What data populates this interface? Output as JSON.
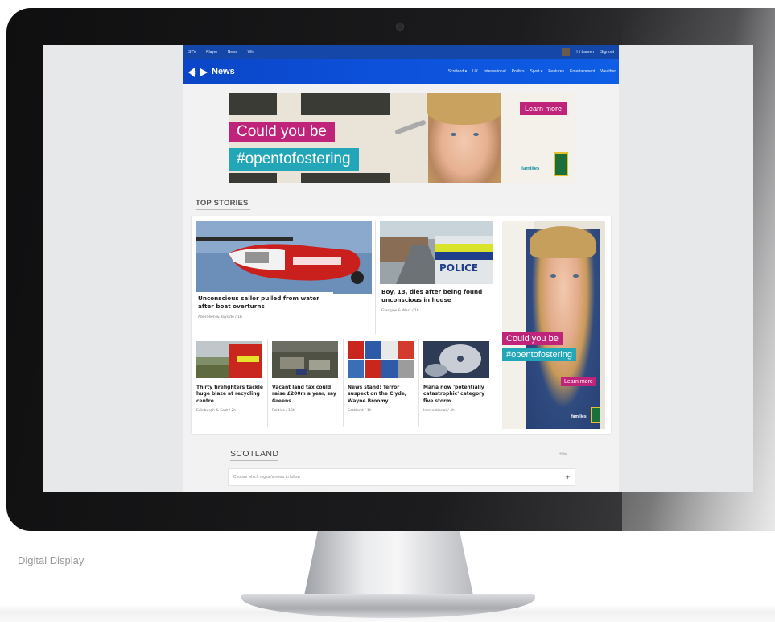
{
  "caption": "Digital Display",
  "util_bar": {
    "links": [
      "STV",
      "Player",
      "News",
      "Win"
    ],
    "user": "Hi Lauren",
    "signout": "Signout"
  },
  "nav": {
    "logo": "News",
    "items": [
      "Scotland ▾",
      "UK",
      "International",
      "Politics",
      "Sport ▾",
      "Features",
      "Entertainment",
      "Weather"
    ]
  },
  "ad_banner": {
    "line1": "Could you be",
    "line2": "#opentofostering",
    "cta": "Learn more",
    "brand": "families"
  },
  "top_stories": {
    "title": "TOP STORIES",
    "lead": [
      {
        "headline": "Unconscious sailor pulled from water after boat overturns",
        "meta": "Aberdeen & Tayside  /  1h"
      },
      {
        "headline": "Boy, 13, dies after being found unconscious in house",
        "meta": "Glasgow & West  /  1h"
      }
    ],
    "small": [
      {
        "headline": "Thirty firefighters tackle huge blaze at recycling centre",
        "meta": "Edinburgh & East  /  2h"
      },
      {
        "headline": "Vacant land tax could raise £200m a year, say Greens",
        "meta": "Politics  /  18h"
      },
      {
        "headline": "News stand: Terror suspect on the Clyde, Wayne Broomy",
        "meta": "Scotland  /  1h"
      },
      {
        "headline": "Maria now 'potentially catastrophic' category five storm",
        "meta": "International  /  4h"
      }
    ]
  },
  "side_ad": {
    "line1": "Could you be",
    "line2": "#opentofostering",
    "cta": "Learn more",
    "brand": "families"
  },
  "scotland": {
    "title": "SCOTLAND",
    "hide": "Hide",
    "placeholder": "Choose which region's news to follow",
    "plus": "+"
  }
}
